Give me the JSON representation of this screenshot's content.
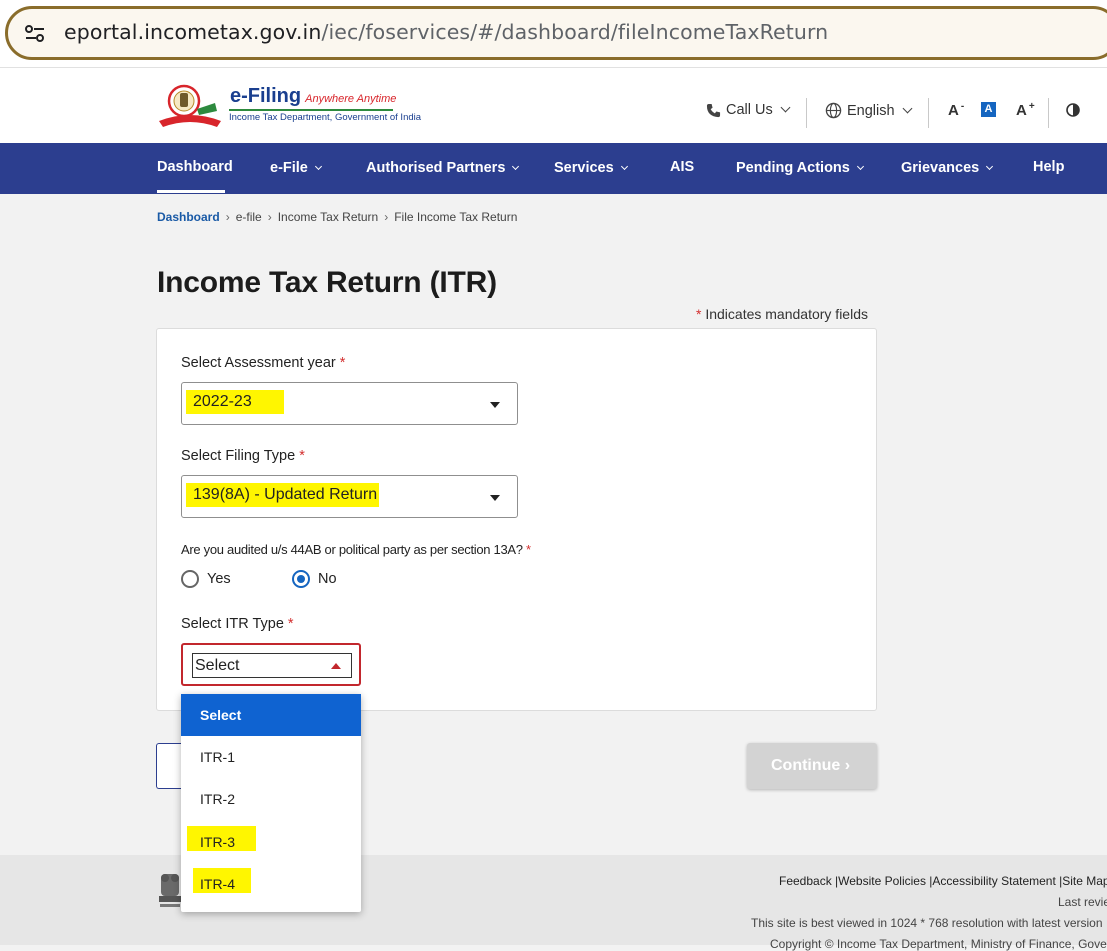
{
  "browser": {
    "url_host": "eportal.incometax.gov.in",
    "url_path": "/iec/foservices/#/dashboard/fileIncomeTaxReturn"
  },
  "header": {
    "logo_title": "e-Filing",
    "logo_tagline": "Anywhere Anytime",
    "logo_subtitle": "Income Tax Department, Government of India",
    "call_us": "Call Us",
    "language": "English",
    "font_decrease": "A",
    "font_normal": "A",
    "font_increase": "A"
  },
  "nav": {
    "items": [
      {
        "label": "Dashboard"
      },
      {
        "label": "e-File"
      },
      {
        "label": "Authorised Partners"
      },
      {
        "label": "Services"
      },
      {
        "label": "AIS"
      },
      {
        "label": "Pending Actions"
      },
      {
        "label": "Grievances"
      },
      {
        "label": "Help"
      }
    ]
  },
  "breadcrumb": [
    "Dashboard",
    "e-file",
    "Income Tax Return",
    "File Income Tax Return"
  ],
  "page": {
    "title": "Income Tax Return (ITR)",
    "mandatory_note": "Indicates mandatory fields"
  },
  "form": {
    "assessment_year_label": "Select Assessment year",
    "assessment_year_value": "2022-23",
    "filing_type_label": "Select Filing Type",
    "filing_type_value": "139(8A) - Updated Return",
    "audit_question": "Are you audited u/s 44AB or political party as per section 13A?",
    "radio_yes": "Yes",
    "radio_no": "No",
    "itr_type_label": "Select ITR Type",
    "itr_type_value": "Select",
    "itr_options": [
      "Select",
      "ITR-1",
      "ITR-2",
      "ITR-3",
      "ITR-4"
    ],
    "continue_label": "Continue"
  },
  "footer": {
    "links": "Feedback |Website Policies |Accessibility Statement |Site Map",
    "last_reviewed": "Last review",
    "best_viewed": "This site is best viewed in 1024 * 768 resolution with latest version",
    "copyright": "Copyright © Income Tax Department, Ministry of Finance, Gove"
  },
  "colors": {
    "nav_bg": "#2c3e8f",
    "highlight": "#fff600",
    "selected_option": "#0f63d1",
    "error_border": "#c2272d"
  }
}
